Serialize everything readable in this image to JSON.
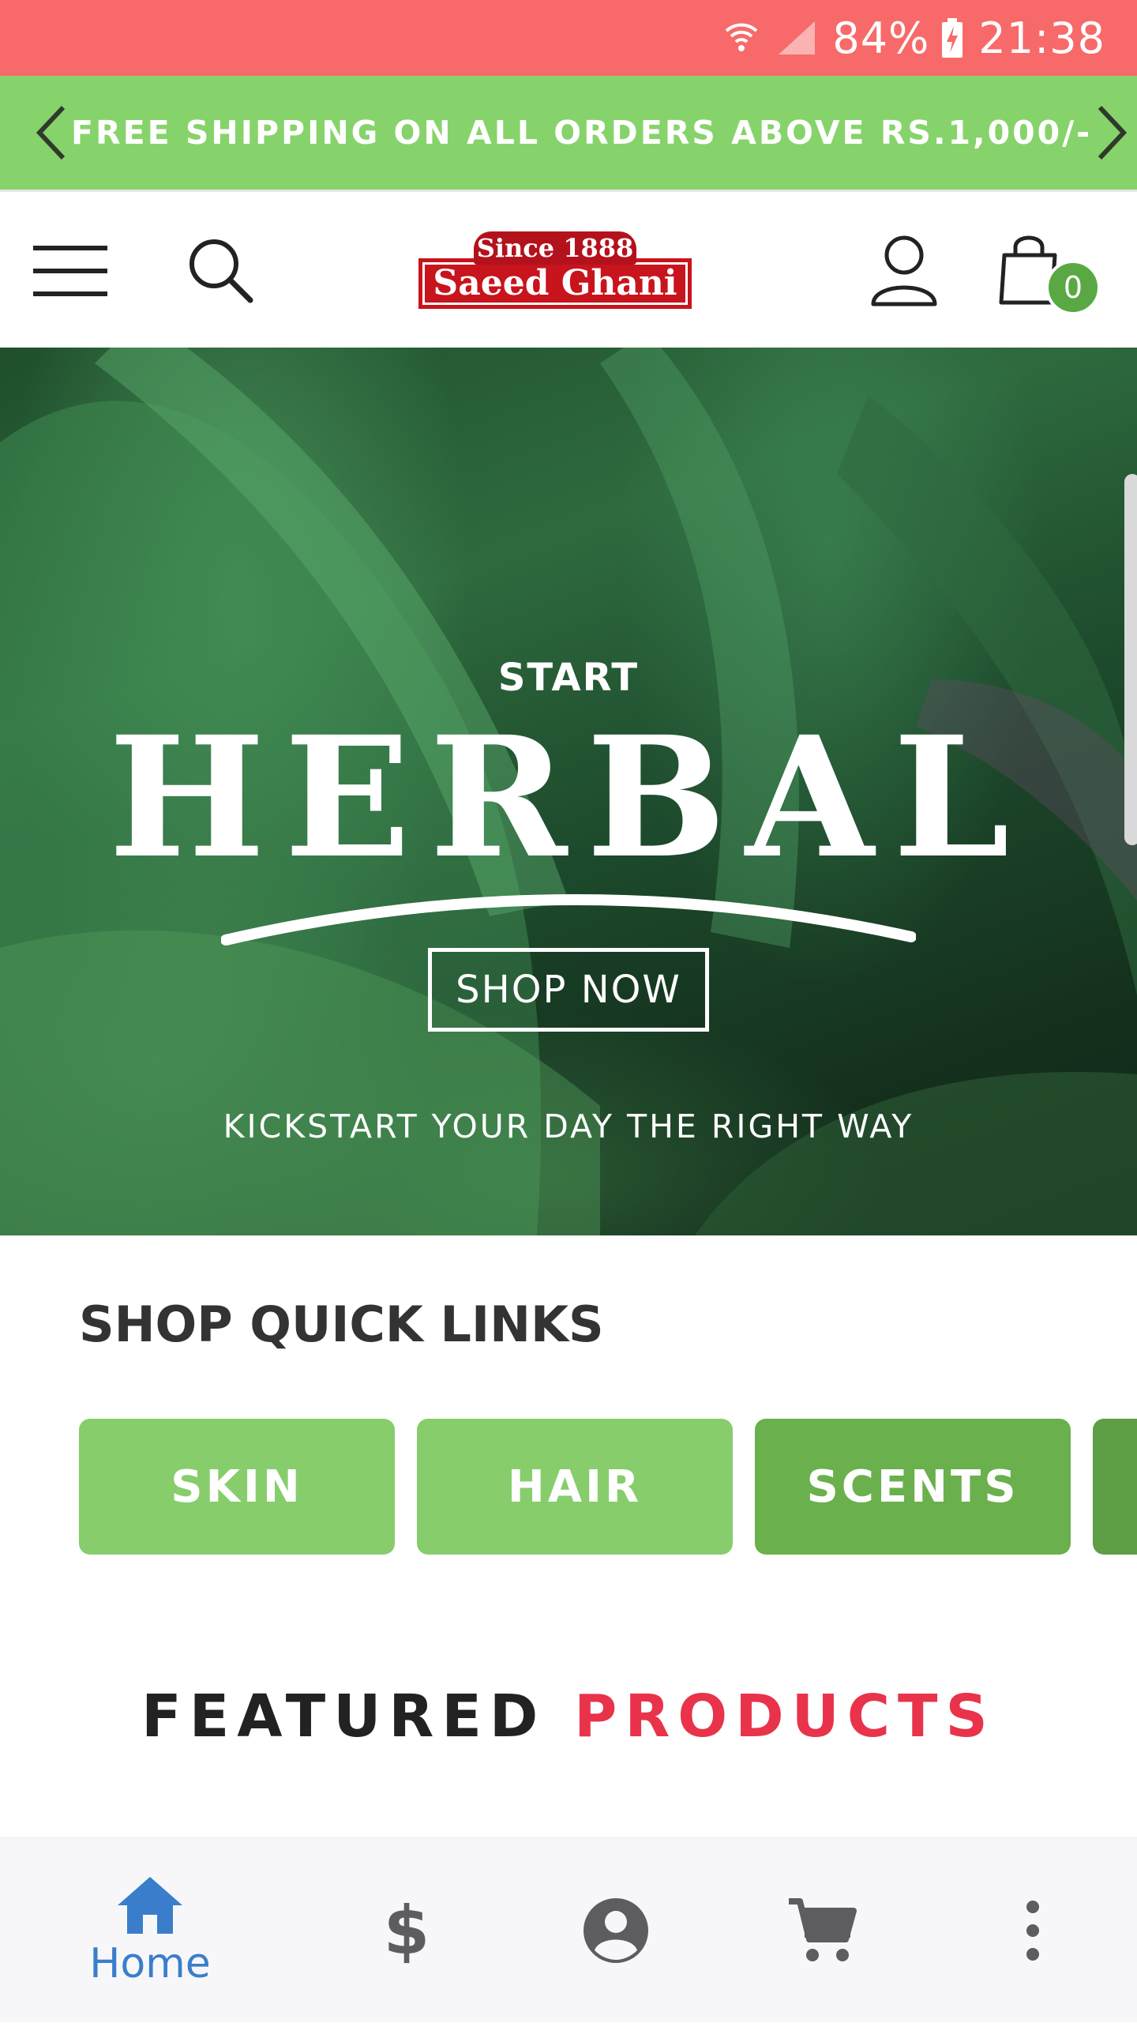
{
  "status_bar": {
    "battery": "84%",
    "time": "21:38"
  },
  "promo": {
    "text": "FREE SHIPPING ON ALL ORDERS ABOVE RS.1,000/-"
  },
  "header": {
    "logo_since": "Since 1888",
    "logo_name": "Saeed Ghani",
    "cart_count": "0"
  },
  "hero": {
    "start": "START",
    "title": "HERBAL",
    "button": "SHOP NOW",
    "tagline": "KICKSTART YOUR DAY THE RIGHT WAY"
  },
  "quick_links": {
    "title": "SHOP QUICK LINKS",
    "items": [
      {
        "label": "SKIN",
        "color": "#87cd6c"
      },
      {
        "label": "HAIR",
        "color": "#87cd6c"
      },
      {
        "label": "SCENTS",
        "color": "#6ab04c"
      },
      {
        "label": "",
        "color": "#5e9e45"
      }
    ]
  },
  "featured": {
    "part1": "FEATURED",
    "part2": "PRODUCTS"
  },
  "bottom_nav": {
    "items": [
      {
        "icon": "home-icon",
        "label": "Home"
      },
      {
        "icon": "dollar-icon",
        "label": ""
      },
      {
        "icon": "account-circle-icon",
        "label": ""
      },
      {
        "icon": "cart-icon",
        "label": ""
      },
      {
        "icon": "more-vert-icon",
        "label": ""
      }
    ]
  },
  "colors": {
    "status_bar": "#f76a69",
    "promo_bar": "#87d36b",
    "accent_red": "#e8334a",
    "nav_active": "#3a7ecb"
  }
}
